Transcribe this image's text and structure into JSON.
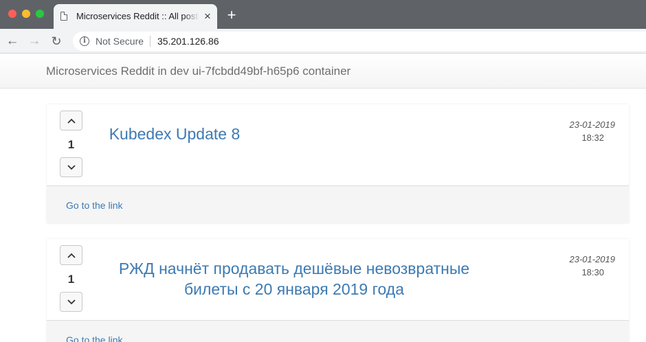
{
  "browser": {
    "tab_title": "Microservices Reddit :: All posts",
    "tab_close": "×",
    "new_tab": "+",
    "security_label": "Not Secure",
    "url": "35.201.126.86",
    "icons": {
      "back": "←",
      "forward": "→",
      "reload": "↻",
      "info": "i"
    },
    "colors": {
      "tabstrip": "#5f6368",
      "toolbar": "#f1f3f4"
    }
  },
  "page": {
    "brand": "Microservices Reddit in dev ui-7fcbdd49bf-h65p6 container",
    "link_color": "#3d7ab2",
    "posts": [
      {
        "title": "Kubedex Update 8",
        "votes": "1",
        "date": "23-01-2019",
        "time": "18:32",
        "link_label": "Go to the link",
        "upvote_icon": "chevron-up-icon",
        "downvote_icon": "chevron-down-icon"
      },
      {
        "title": "РЖД начнёт продавать дешёвые невозвратные билеты с 20 января 2019 года",
        "votes": "1",
        "date": "23-01-2019",
        "time": "18:30",
        "link_label": "Go to the link",
        "upvote_icon": "chevron-up-icon",
        "downvote_icon": "chevron-down-icon"
      }
    ]
  }
}
